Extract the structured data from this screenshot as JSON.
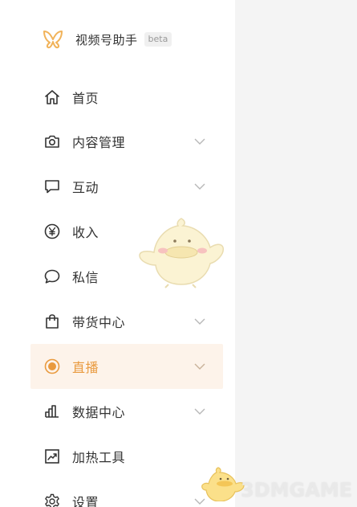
{
  "brand": {
    "name": "视频号助手",
    "badge": "beta",
    "logo": "butterfly-logo"
  },
  "nav": {
    "items": [
      {
        "label": "首页",
        "icon": "home-icon",
        "expandable": false,
        "active": false
      },
      {
        "label": "内容管理",
        "icon": "camera-icon",
        "expandable": true,
        "active": false
      },
      {
        "label": "互动",
        "icon": "message-square-icon",
        "expandable": true,
        "active": false
      },
      {
        "label": "收入",
        "icon": "yen-circle-icon",
        "expandable": false,
        "active": false
      },
      {
        "label": "私信",
        "icon": "chat-bubble-icon",
        "expandable": false,
        "active": false
      },
      {
        "label": "带货中心",
        "icon": "shopping-bag-icon",
        "expandable": true,
        "active": false
      },
      {
        "label": "直播",
        "icon": "live-dot-icon",
        "expandable": true,
        "active": true
      },
      {
        "label": "数据中心",
        "icon": "bar-chart-icon",
        "expandable": true,
        "active": false
      },
      {
        "label": "加热工具",
        "icon": "trend-chart-icon",
        "expandable": false,
        "active": false
      },
      {
        "label": "设置",
        "icon": "gear-icon",
        "expandable": true,
        "active": false
      }
    ]
  },
  "watermark": {
    "text": "3DMGAME"
  },
  "colors": {
    "accent": "#e99a3e",
    "active_bg": "#fdf3ea",
    "main_bg": "#f4f4f4",
    "icon": "#333333",
    "chevron": "#b8b8b8"
  }
}
